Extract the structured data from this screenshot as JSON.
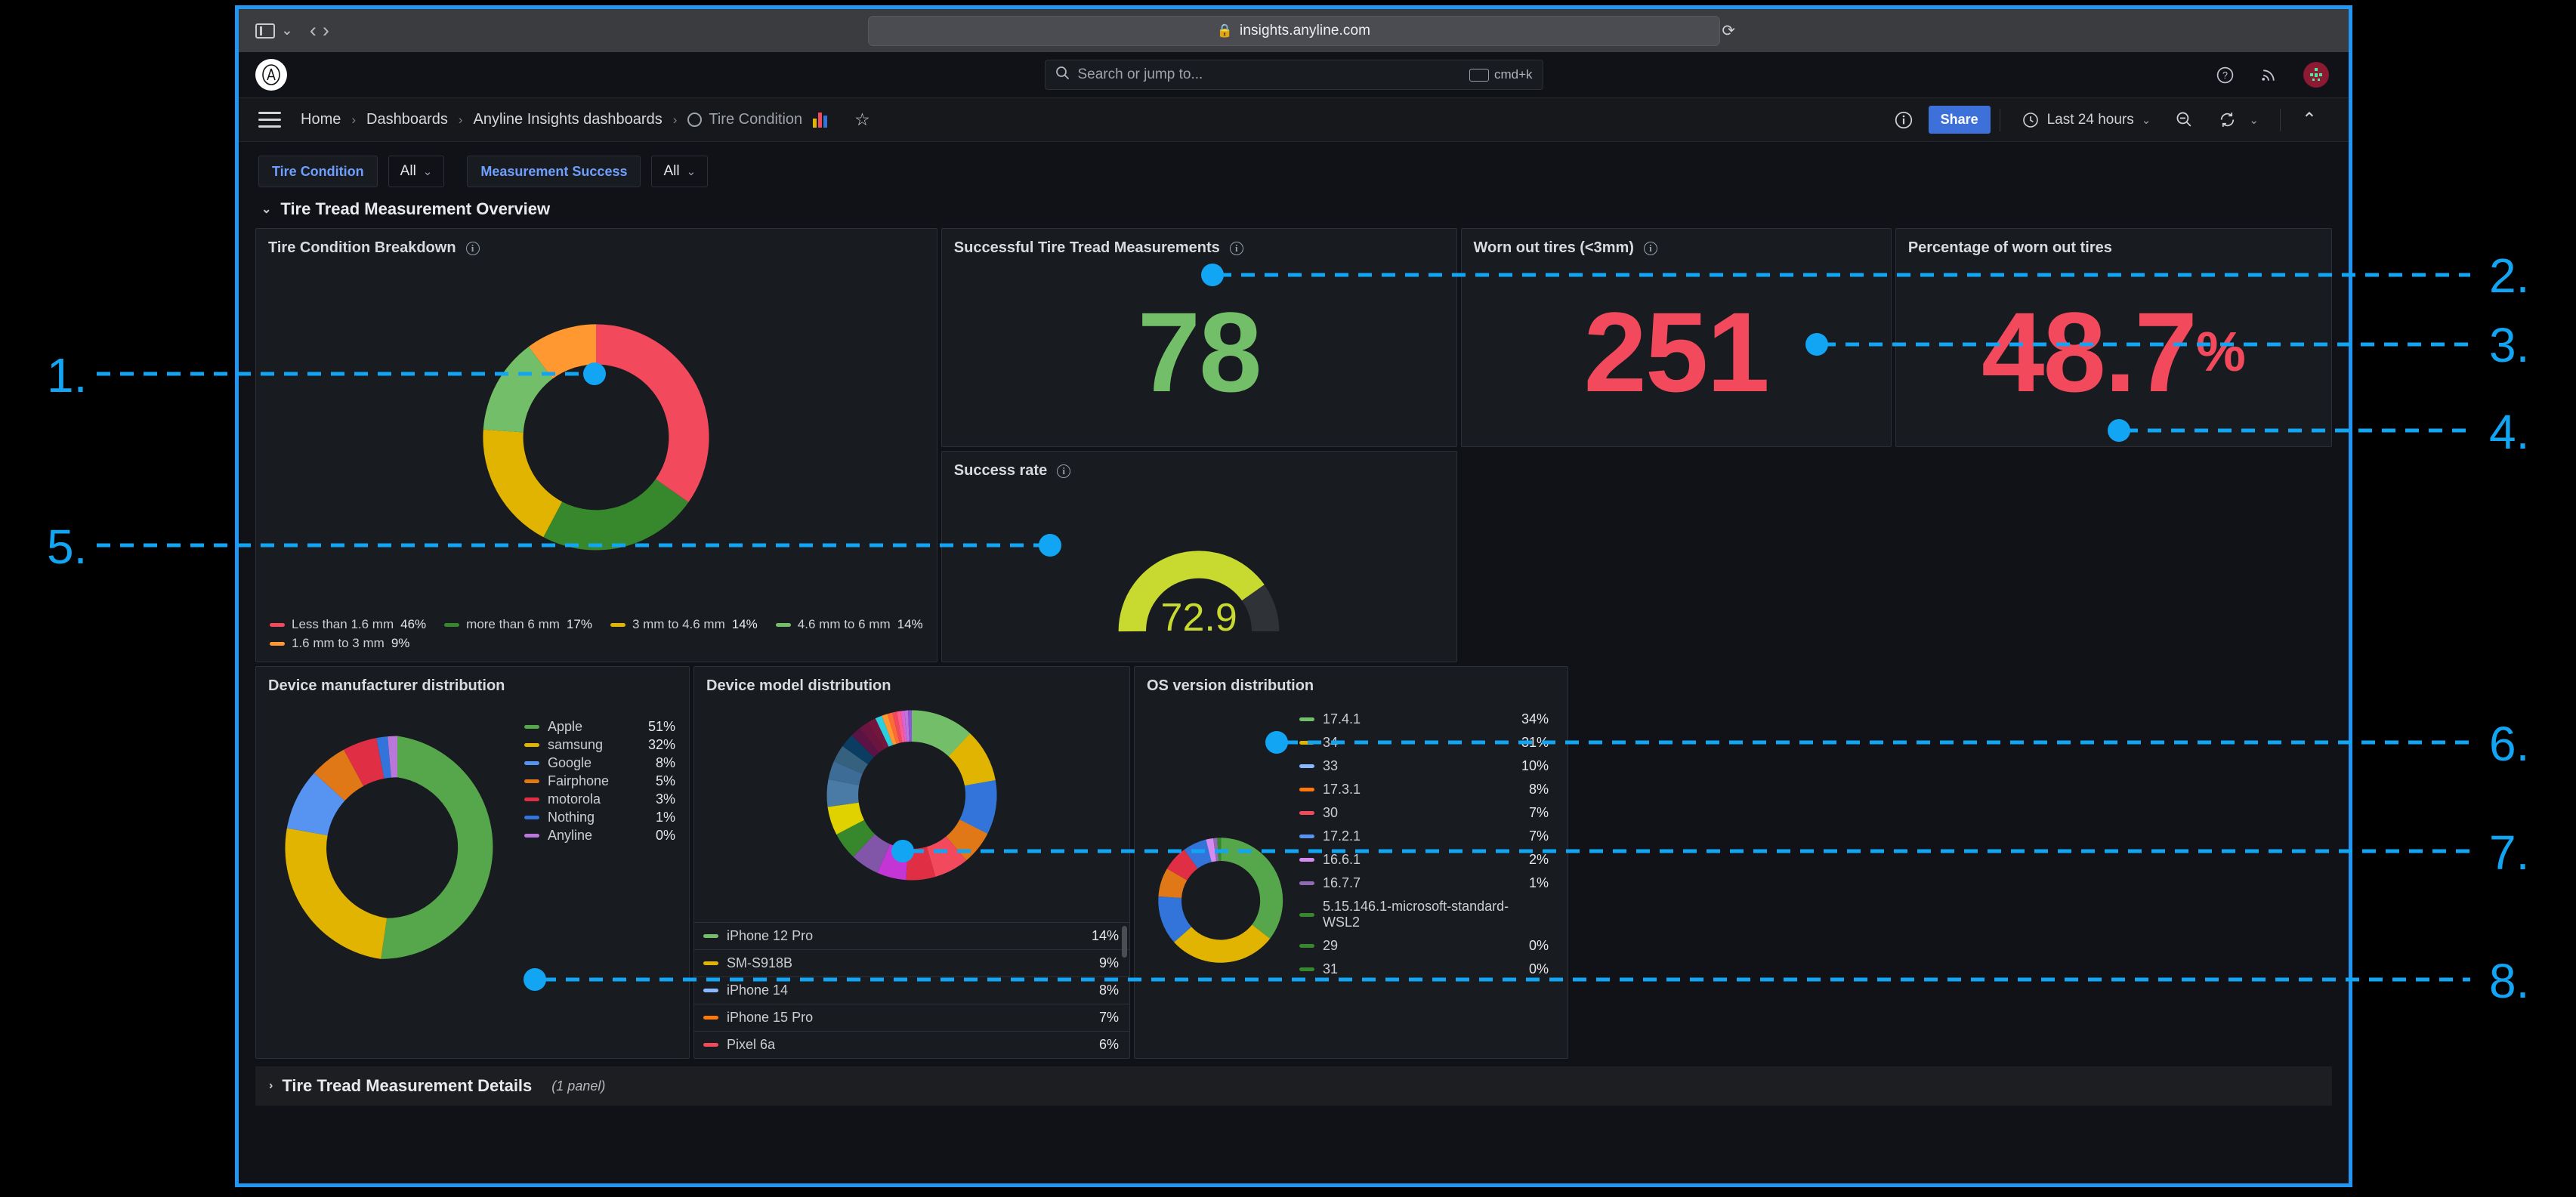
{
  "browser": {
    "url": "insights.anyline.com",
    "lock_icon": "lock-icon",
    "reload_icon": "reload-icon",
    "back_icon": "back-arrow-icon",
    "forward_icon": "forward-arrow-icon",
    "sidebar_icon": "sidebar-toggle-icon",
    "tab_chevron_icon": "chevron-down-icon"
  },
  "topnav": {
    "logo_icon": "anyline-logo-icon",
    "search_placeholder": "Search or jump to...",
    "search_icon": "search-icon",
    "shortcut_label": "cmd+k",
    "keyboard_icon": "keyboard-icon",
    "help_icon": "help-circle-icon",
    "news_icon": "rss-news-icon",
    "avatar_icon": "user-avatar-icon"
  },
  "breadcrumb": {
    "menu_icon": "hamburger-menu-icon",
    "items": [
      {
        "label": "Home"
      },
      {
        "label": "Dashboards"
      },
      {
        "label": "Anyline Insights dashboards"
      },
      {
        "label": "Tire Condition"
      }
    ],
    "separator": "›",
    "dashboard_icon": "dashboard-circle-icon",
    "panel_icon": "bar-chart-icon",
    "star_icon": "star-outline-icon"
  },
  "toolbar": {
    "info_icon": "info-circle-icon",
    "share_label": "Share",
    "time_range_label": "Last 24 hours",
    "clock_icon": "clock-icon",
    "time_chevron_icon": "chevron-down-icon",
    "zoom_out_icon": "zoom-out-icon",
    "refresh_icon": "refresh-icon",
    "refresh_chevron_icon": "chevron-down-icon",
    "collapse_icon": "chevron-up-icon"
  },
  "filters": [
    {
      "label": "Tire Condition",
      "value": "All",
      "chevron_icon": "chevron-down-icon"
    },
    {
      "label": "Measurement Success",
      "value": "All",
      "chevron_icon": "chevron-down-icon"
    }
  ],
  "sections": [
    {
      "title": "Tire Tread Measurement Overview",
      "expanded": true,
      "toggle_icon": "chevron-down-icon",
      "sub": ""
    },
    {
      "title": "Tire Tread Measurement Details",
      "expanded": false,
      "toggle_icon": "chevron-right-icon",
      "sub": "(1 panel)"
    }
  ],
  "panels": {
    "tire_condition_breakdown": {
      "title": "Tire Condition Breakdown",
      "info_icon": "info-circle-icon"
    },
    "successful_measurements": {
      "title": "Successful Tire Tread Measurements",
      "info_icon": "info-circle-icon",
      "value": "78",
      "color": "#73bf69"
    },
    "worn_out_tires": {
      "title": "Worn out tires (<3mm)",
      "info_icon": "info-circle-icon",
      "value": "251",
      "color": "#f2495c"
    },
    "percentage_worn_out": {
      "title": "Percentage of worn out tires",
      "value": "48.7",
      "suffix": "%",
      "color": "#f2495c"
    },
    "success_rate": {
      "title": "Success rate",
      "info_icon": "info-circle-icon",
      "value": "72.9",
      "color": "#c8d92f"
    },
    "device_manufacturer": {
      "title": "Device manufacturer distribution"
    },
    "device_model": {
      "title": "Device model distribution"
    },
    "os_version": {
      "title": "OS version distribution"
    }
  },
  "chart_data": [
    {
      "type": "pie",
      "title": "Tire Condition Breakdown",
      "legend_position": "bottom",
      "labels": [
        "Less than 1.6 mm",
        "more than 6 mm",
        "3 mm to 4.6 mm",
        "4.6 mm to 6 mm",
        "1.6 mm to 3 mm"
      ],
      "values": [
        46,
        17,
        14,
        14,
        9
      ],
      "value_labels": [
        "46%",
        "17%",
        "14%",
        "14%",
        "9%"
      ],
      "colors": [
        "#f2495c",
        "#37872d",
        "#e0b400",
        "#73bf69",
        "#ff9830"
      ]
    },
    {
      "type": "gauge",
      "title": "Success rate",
      "value": 72.9,
      "display_value": "72.9",
      "min": 0,
      "max": 100,
      "color": "#c8d92f"
    },
    {
      "type": "pie",
      "title": "Device manufacturer distribution",
      "legend_position": "right",
      "labels": [
        "Apple",
        "samsung",
        "Google",
        "Fairphone",
        "motorola",
        "Nothing",
        "Anyline"
      ],
      "values": [
        51,
        32,
        8,
        5,
        3,
        1,
        0
      ],
      "value_labels": [
        "51%",
        "32%",
        "8%",
        "5%",
        "3%",
        "1%",
        "0%"
      ],
      "colors": [
        "#56a64b",
        "#e0b400",
        "#5794f2",
        "#e07818",
        "#e02f44",
        "#3274d9",
        "#b877d9"
      ]
    },
    {
      "type": "pie",
      "title": "Device model distribution",
      "legend_position": "bottom-table",
      "labels": [
        "iPhone 12 Pro",
        "SM-S918B",
        "iPhone 14",
        "iPhone 15 Pro",
        "Pixel 6a"
      ],
      "values": [
        14,
        9,
        8,
        7,
        6
      ],
      "value_labels": [
        "14%",
        "9%",
        "8%",
        "7%",
        "6%"
      ],
      "colors": [
        "#73bf69",
        "#e0b400",
        "#8ab8ff",
        "#ff780a",
        "#f2495c"
      ]
    },
    {
      "type": "pie",
      "title": "OS version distribution",
      "legend_position": "right",
      "labels": [
        "17.4.1",
        "34",
        "33",
        "17.3.1",
        "30",
        "17.2.1",
        "16.6.1",
        "16.7.7",
        "5.15.146.1-microsoft-standard-WSL2",
        "29",
        "31"
      ],
      "values": [
        34,
        31,
        10,
        8,
        7,
        7,
        2,
        1,
        0,
        0,
        0
      ],
      "value_labels": [
        "34%",
        "31%",
        "10%",
        "8%",
        "7%",
        "7%",
        "2%",
        "1%",
        "",
        "0%",
        "0%"
      ],
      "colors": [
        "#73bf69",
        "#e0b400",
        "#8ab8ff",
        "#ff780a",
        "#f2495c",
        "#5794f2",
        "#d58cf0",
        "#8f6bb5",
        "#37872d",
        "#37872d",
        "#37872d"
      ]
    }
  ],
  "annotations": [
    {
      "number": "1."
    },
    {
      "number": "2."
    },
    {
      "number": "3."
    },
    {
      "number": "4."
    },
    {
      "number": "5."
    },
    {
      "number": "6."
    },
    {
      "number": "7."
    },
    {
      "number": "8."
    }
  ]
}
